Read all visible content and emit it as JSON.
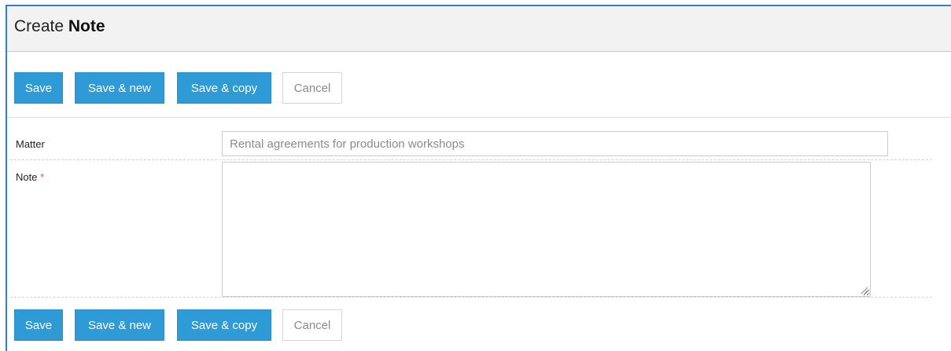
{
  "header": {
    "title_prefix": "Create",
    "title_entity": "Note"
  },
  "toolbar": {
    "save_label": "Save",
    "save_new_label": "Save & new",
    "save_copy_label": "Save & copy",
    "cancel_label": "Cancel"
  },
  "form": {
    "matter": {
      "label": "Matter",
      "value": "Rental agreements for production workshops"
    },
    "note": {
      "label": "Note",
      "required_mark": "*",
      "value": ""
    }
  },
  "colors": {
    "primary_button": "#2e9ad6",
    "frame_border": "#2e7fd3",
    "header_background": "#f2f2f2",
    "required_mark": "#d9534f"
  },
  "icons": {
    "textarea_resize": "resize-grip-icon"
  }
}
